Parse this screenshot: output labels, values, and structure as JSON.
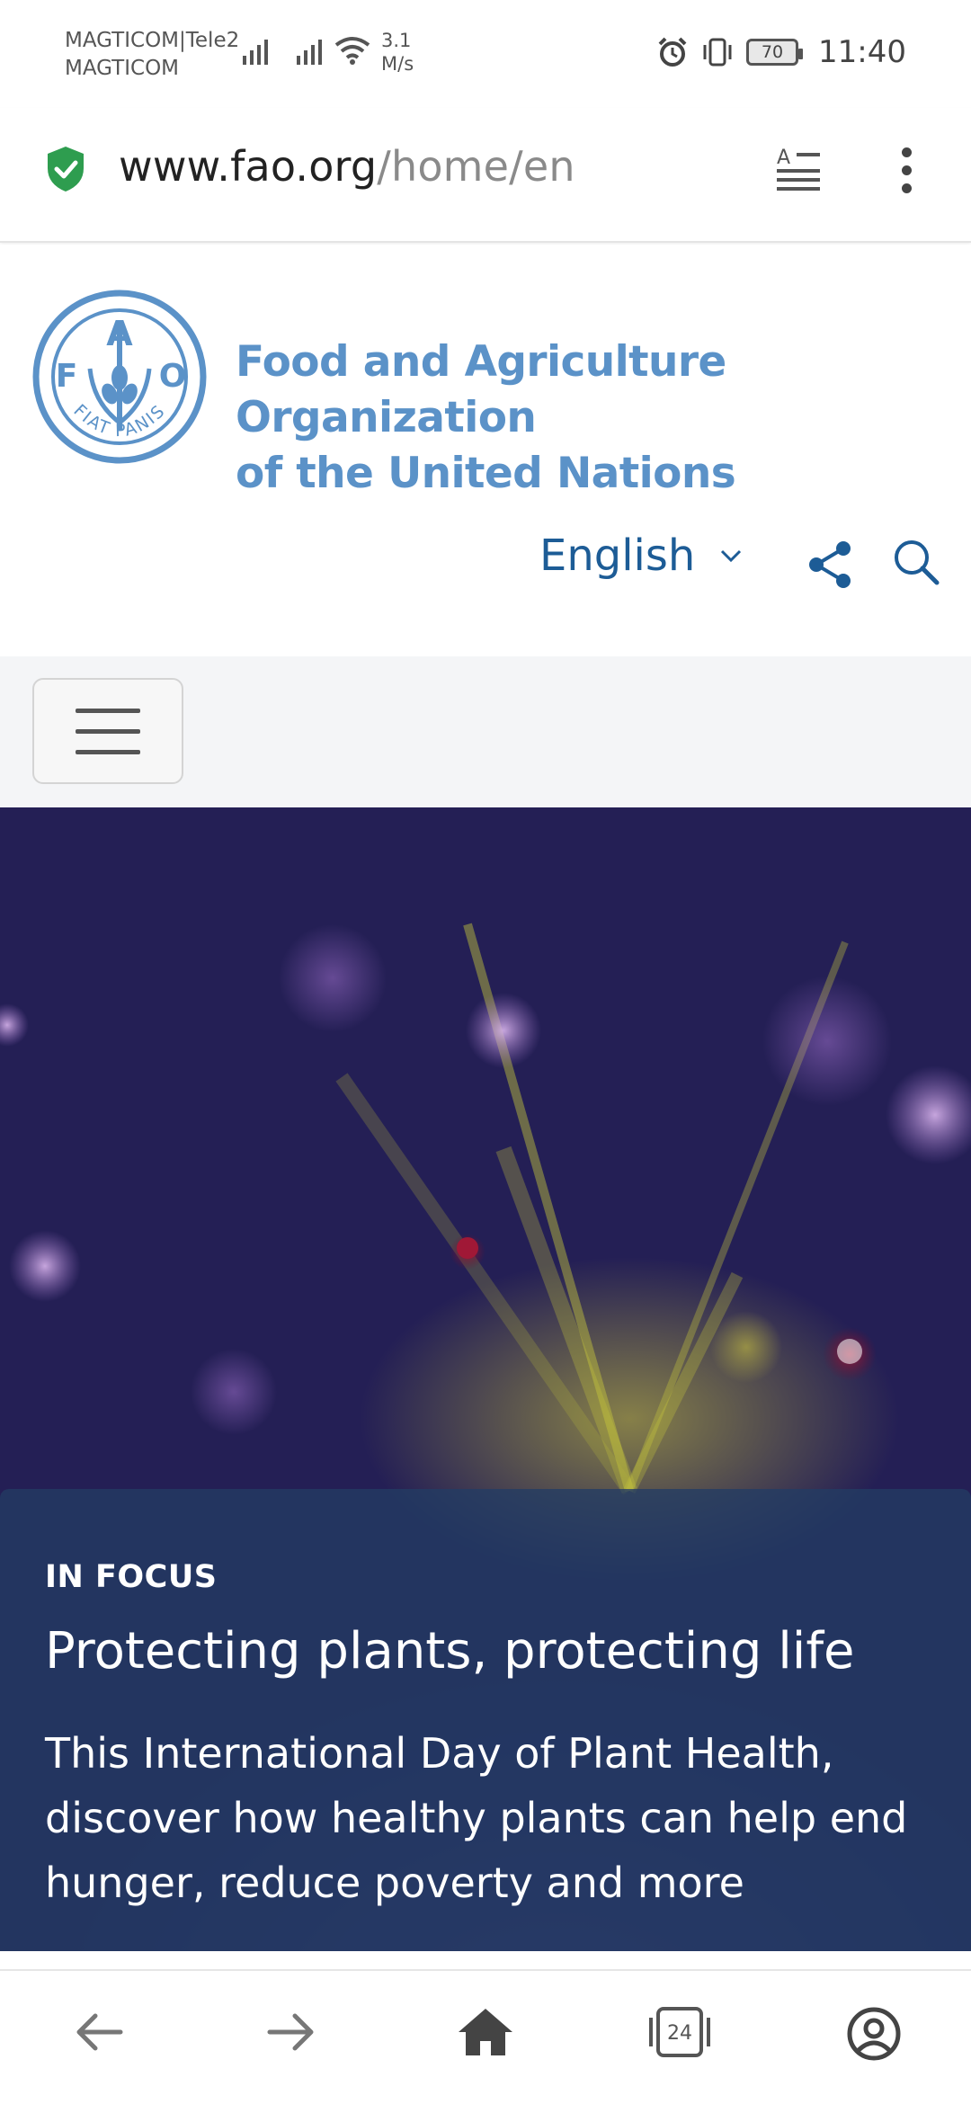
{
  "status_bar": {
    "carrier_1": "MAGTICOM|Tele2",
    "carrier_2": "MAGTICOM",
    "net_speed_value": "3.1",
    "net_speed_unit": "M/s",
    "battery_level": "70",
    "time": "11:40"
  },
  "browser": {
    "url_host": "www.fao.org",
    "url_path": "/home/en",
    "tab_count": "24"
  },
  "header": {
    "org_name_line1": "Food and Agriculture Organization",
    "org_name_line2": "of the United Nations",
    "logo_letters": [
      "F",
      "A",
      "O"
    ],
    "logo_motto": "FIAT PANIS",
    "language": "English"
  },
  "hero": {
    "kicker": "IN FOCUS",
    "title": "Protecting plants, protecting life",
    "description": "This International Day of Plant Health, discover how healthy plants can help end hunger, reduce poverty and more"
  },
  "colors": {
    "fao_blue": "#5b92c8",
    "link_blue": "#1d5c96",
    "secure_green": "#2e9d4f"
  },
  "icons": {
    "secure": "shield-check-icon",
    "reader": "reader-mode-icon",
    "menu": "more-vertical-icon",
    "share": "share-icon",
    "search": "search-icon",
    "hamburger": "hamburger-icon",
    "back": "arrow-left-icon",
    "forward": "arrow-right-icon",
    "home": "home-icon",
    "tabs": "tabs-icon",
    "profile": "profile-icon"
  }
}
